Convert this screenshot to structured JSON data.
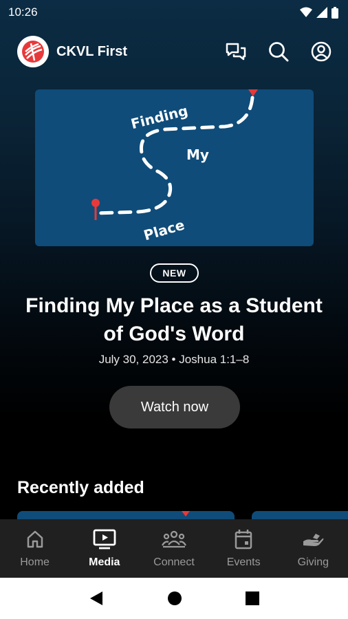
{
  "status_bar": {
    "time": "10:26",
    "icons": [
      "wifi-icon",
      "cellular-icon",
      "battery-icon"
    ]
  },
  "header": {
    "title": "CKVL First",
    "icons": [
      "chat-icon",
      "search-icon",
      "account-icon"
    ]
  },
  "hero": {
    "artwork_text": {
      "line1": "Finding",
      "line2": "My",
      "line3": "Place"
    },
    "badge": "NEW",
    "title": "Finding My Place as a Student of God's Word",
    "meta": "July 30, 2023 • Joshua 1:1–8",
    "button_label": "Watch now"
  },
  "recently_added": {
    "title": "Recently added"
  },
  "bottom_nav": {
    "items": [
      {
        "label": "Home",
        "icon": "home-icon",
        "active": false
      },
      {
        "label": "Media",
        "icon": "media-icon",
        "active": true
      },
      {
        "label": "Connect",
        "icon": "connect-icon",
        "active": false
      },
      {
        "label": "Events",
        "icon": "calendar-icon",
        "active": false
      },
      {
        "label": "Giving",
        "icon": "giving-icon",
        "active": false
      }
    ]
  },
  "system_nav": {
    "icons": [
      "back-icon",
      "home-circle-icon",
      "recents-icon"
    ]
  },
  "colors": {
    "accent_red": "#e8393a",
    "art_blue": "#0f4c79",
    "nav_bg": "#202020",
    "button_bg": "#3a3a3a"
  }
}
